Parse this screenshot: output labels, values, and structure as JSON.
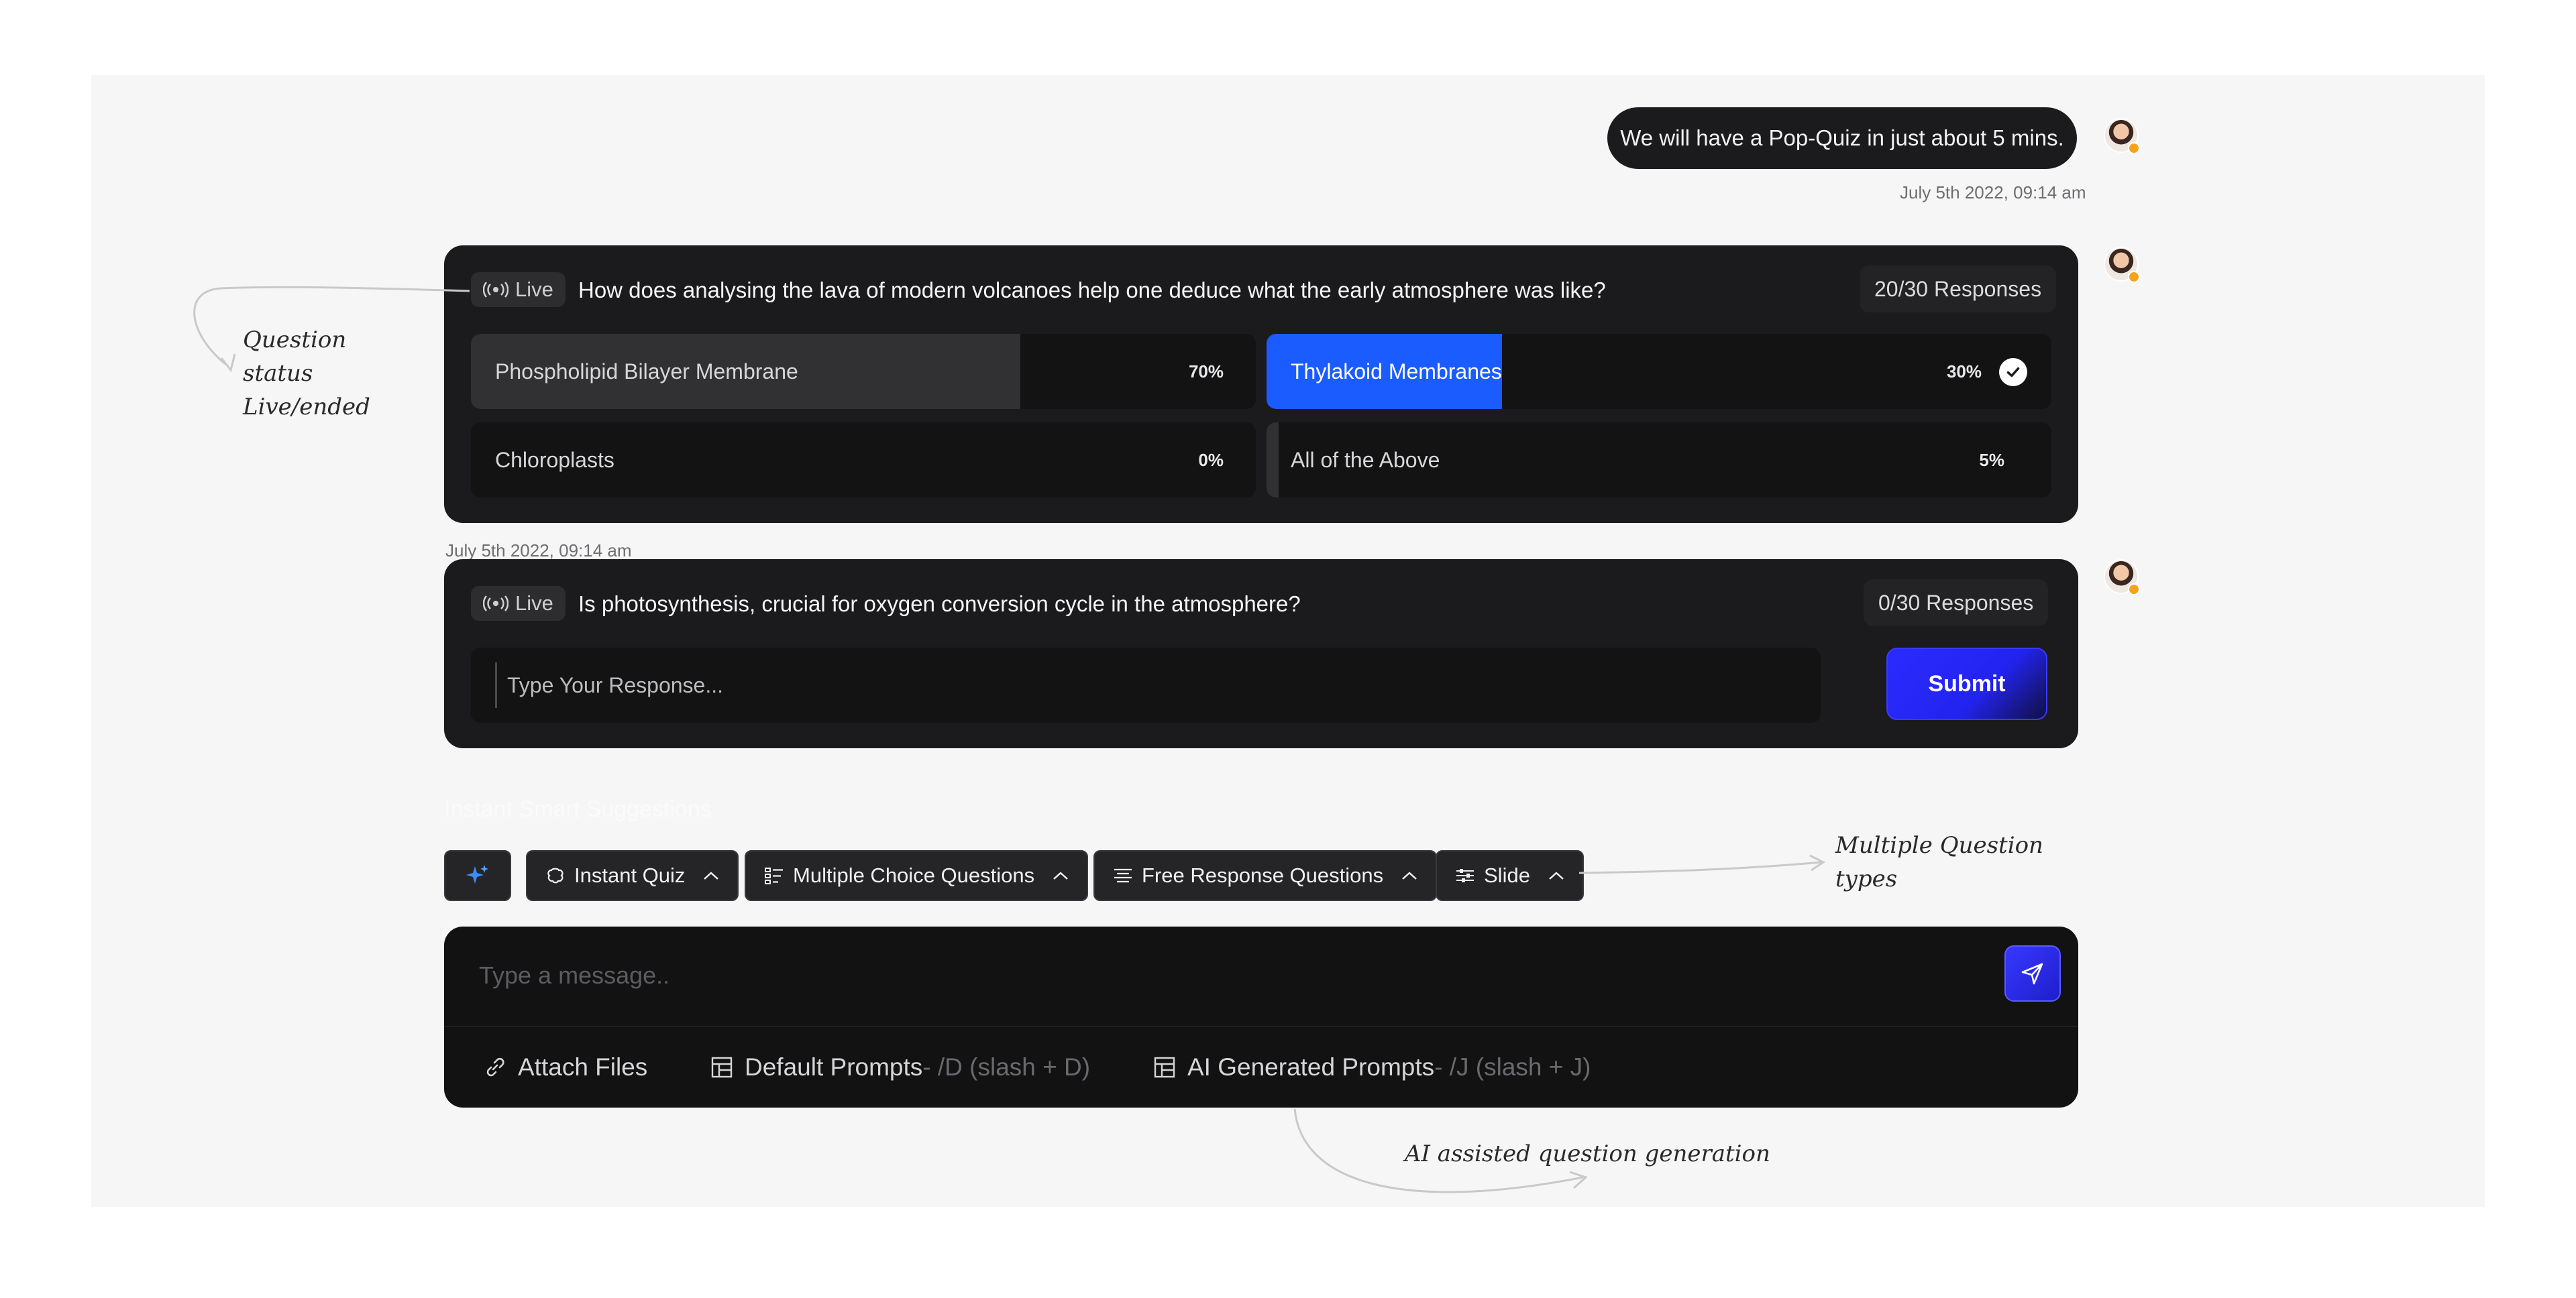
{
  "chat": {
    "message": "We will have a Pop-Quiz in just about 5 mins.",
    "message_timestamp": "July 5th 2022, 09:14 am"
  },
  "question1": {
    "status": "Live",
    "text": "How does analysing the lava of modern volcanoes help one deduce what the early atmosphere was like?",
    "responses": "20/30 Responses",
    "timestamp": "July 5th 2022, 09:14 am",
    "options": [
      {
        "label": "Phospholipid Bilayer Membrane",
        "percent_text": "70%",
        "percent": 70,
        "selected": false
      },
      {
        "label": "Thylakoid Membranes",
        "percent_text": "30%",
        "percent": 30,
        "selected": true
      },
      {
        "label": "Chloroplasts",
        "percent_text": "0%",
        "percent": 0,
        "selected": false
      },
      {
        "label": "All of the Above",
        "percent_text": "5%",
        "percent": 5,
        "selected": false
      }
    ]
  },
  "question2": {
    "status": "Live",
    "text": "Is photosynthesis, crucial for  oxygen conversion  cycle in the atmosphere?",
    "responses": "0/30 Responses",
    "input_placeholder": "Type Your Response...",
    "submit_label": "Submit"
  },
  "suggestions_label": "Instant Smart Suggestions",
  "toolbar": {
    "items": [
      {
        "label": "Instant Quiz",
        "icon": "brain-icon"
      },
      {
        "label": "Multiple Choice Questions",
        "icon": "list-icon"
      },
      {
        "label": "Free Response Questions",
        "icon": "text-lines-icon"
      },
      {
        "label": "Slide",
        "icon": "sliders-icon"
      }
    ]
  },
  "composer": {
    "placeholder": "Type a message..",
    "attach_label": "Attach Files",
    "default_prompts_label": "Default Prompts",
    "default_prompts_hint": " - /D (slash + D)",
    "ai_prompts_label": "AI Generated Prompts",
    "ai_prompts_hint": " - /J (slash + J)"
  },
  "annotations": {
    "status_note_line1": "Question",
    "status_note_line2": "status",
    "status_note_line3": "Live/ended",
    "types_note_line1": "Multiple Question",
    "types_note_line2": "types",
    "ai_note": "AI assisted question generation"
  },
  "colors": {
    "accent_blue": "#1a5cff",
    "submit_blue": "#2b2bff",
    "card_bg": "#1b1b1d",
    "status_dot": "#f6a21c"
  }
}
